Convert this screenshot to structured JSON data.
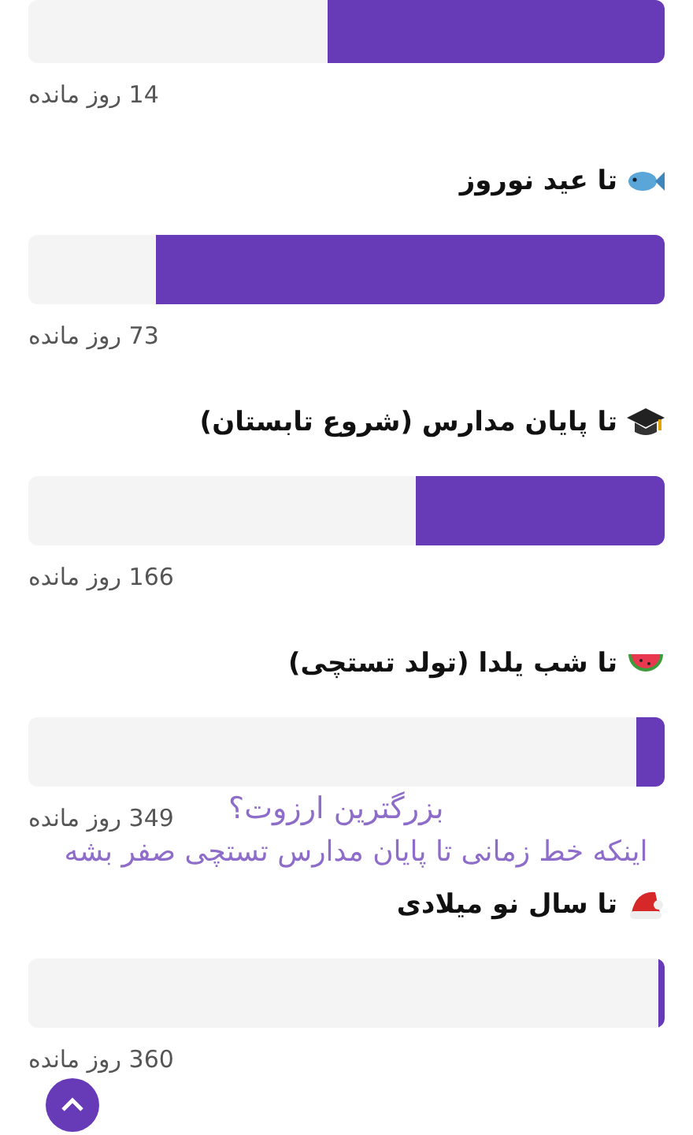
{
  "countdowns": [
    {
      "level": 0.53,
      "remaining": "14 روز مانده"
    },
    {
      "kind": "fish",
      "title": "تا عید نوروز",
      "level": 0.8,
      "remaining": "73 روز مانده"
    },
    {
      "kind": "cap",
      "title": "تا پایان مدارس (شروع تابستان)",
      "level": 0.39,
      "remaining": "166 روز مانده"
    },
    {
      "kind": "melon",
      "title": "تا شب یلدا (تولد تستچی)",
      "level": 0.045,
      "remaining": "349 روز مانده"
    },
    {
      "kind": "hat",
      "title": "تا سال نو میلادی",
      "level": 0.01,
      "remaining": "360 روز مانده"
    }
  ],
  "caption": {
    "question": "بزرگترین ارزوت؟",
    "answer": "اینکه خط زمانی تا پایان مدارس تستچی صفر بشه"
  },
  "scroll_top_button": {
    "kind": "chevron"
  }
}
